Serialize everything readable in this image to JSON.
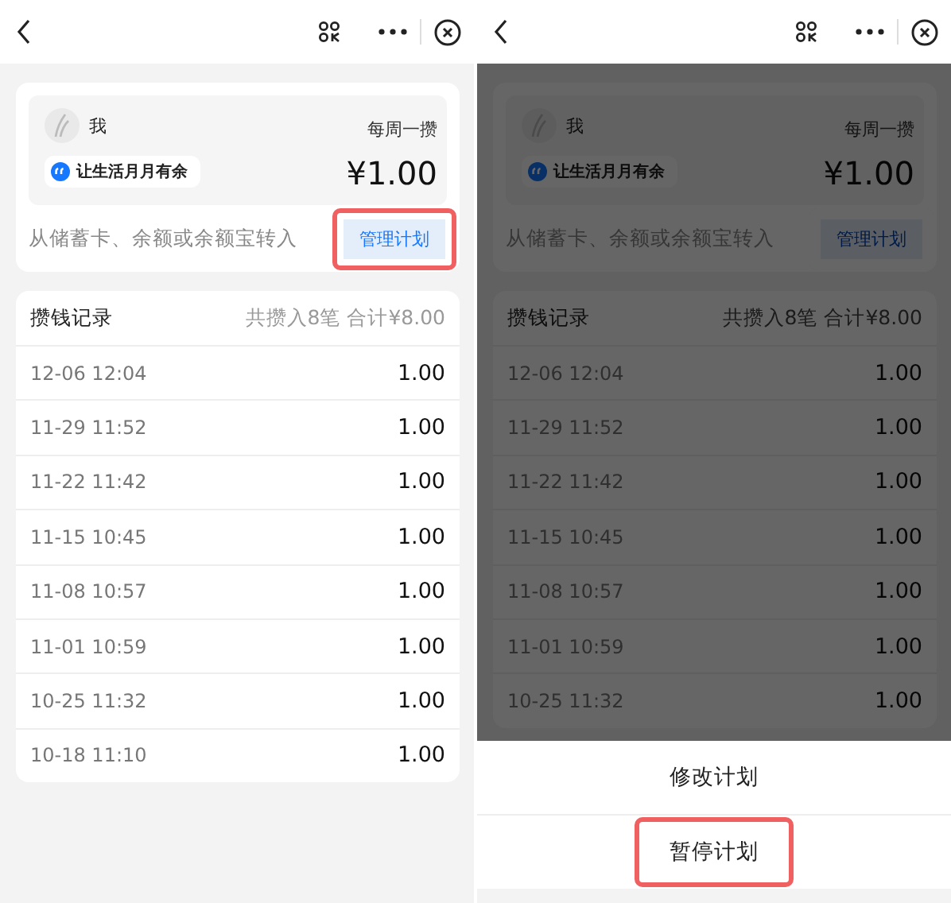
{
  "screens": [
    {
      "dimmed": false,
      "plan": {
        "name": "我",
        "slogan": "让生活月月有余",
        "frequency": "每周一攒",
        "amount": "¥1.00",
        "source": "从储蓄卡、余额或余额宝转入",
        "manage_button": {
          "label": "管理计划",
          "highlighted": true
        }
      },
      "records": {
        "title": "攒钱记录",
        "summary": "共攒入8笔 合计¥8.00",
        "rows": [
          {
            "time": "12-06 12:04",
            "amount": "1.00"
          },
          {
            "time": "11-29 11:52",
            "amount": "1.00"
          },
          {
            "time": "11-22 11:42",
            "amount": "1.00"
          },
          {
            "time": "11-15 10:45",
            "amount": "1.00"
          },
          {
            "time": "11-08 10:57",
            "amount": "1.00"
          },
          {
            "time": "11-01 10:59",
            "amount": "1.00"
          },
          {
            "time": "10-25 11:32",
            "amount": "1.00"
          },
          {
            "time": "10-18 11:10",
            "amount": "1.00"
          }
        ]
      }
    },
    {
      "dimmed": true,
      "plan": {
        "name": "我",
        "slogan": "让生活月月有余",
        "frequency": "每周一攒",
        "amount": "¥1.00",
        "source": "从储蓄卡、余额或余额宝转入",
        "manage_button": {
          "label": "管理计划",
          "highlighted": false
        }
      },
      "records": {
        "title": "攒钱记录",
        "summary": "共攒入8笔 合计¥8.00",
        "rows": [
          {
            "time": "12-06 12:04",
            "amount": "1.00"
          },
          {
            "time": "11-29 11:52",
            "amount": "1.00"
          },
          {
            "time": "11-22 11:42",
            "amount": "1.00"
          },
          {
            "time": "11-15 10:45",
            "amount": "1.00"
          },
          {
            "time": "11-08 10:57",
            "amount": "1.00"
          },
          {
            "time": "11-01 10:59",
            "amount": "1.00"
          },
          {
            "time": "10-25 11:32",
            "amount": "1.00"
          }
        ]
      },
      "action_sheet": {
        "actions": [
          {
            "label": "修改计划",
            "highlighted": false
          },
          {
            "label": "暂停计划",
            "highlighted": true
          }
        ]
      }
    }
  ]
}
